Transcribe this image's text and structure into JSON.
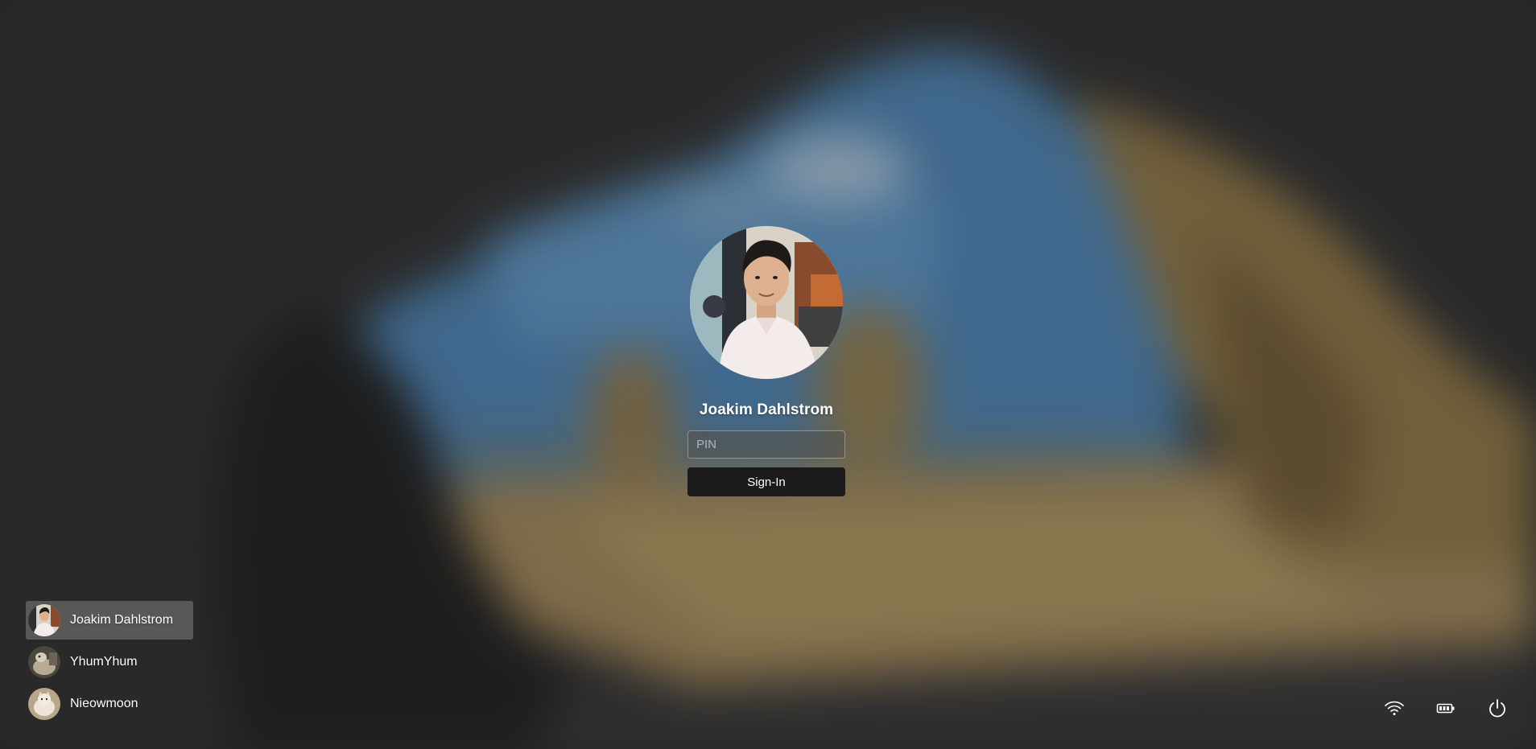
{
  "current_user": {
    "name": "Joakim Dahlstrom",
    "avatar_icon": "user-photo"
  },
  "pin_field": {
    "placeholder": "PIN",
    "value": ""
  },
  "signin_button": {
    "label": "Sign-In"
  },
  "user_list": [
    {
      "name": "Joakim Dahlstrom",
      "selected": true
    },
    {
      "name": "YhumYhum",
      "selected": false
    },
    {
      "name": "Nieowmoon",
      "selected": false
    }
  ],
  "tray": {
    "icons": [
      "wifi-icon",
      "battery-icon",
      "power-icon"
    ]
  },
  "colors": {
    "background_dark": "#2f2f2f",
    "sky": "#4b7fae",
    "sand": "#a48b5d",
    "button_dark": "#1b1b1b",
    "selected_user_bg": "#787878"
  }
}
